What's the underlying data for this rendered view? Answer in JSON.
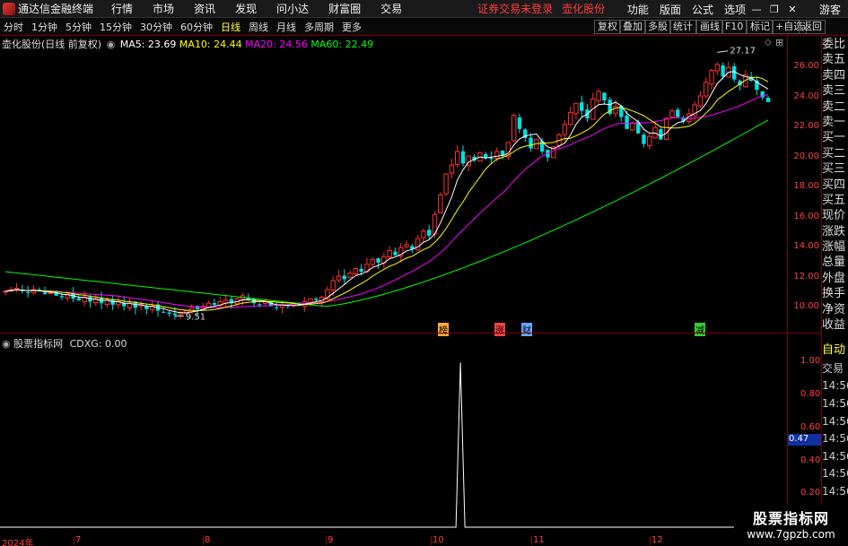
{
  "titlebar": {
    "app_name": "通达信金融终端",
    "menus": [
      "行情",
      "市场",
      "资讯",
      "发现",
      "问小达",
      "财富圈",
      "交易"
    ],
    "warning": "证券交易未登录",
    "stock_name": "壶化股份",
    "right_menus": [
      "功能",
      "版面",
      "公式",
      "选项"
    ],
    "guest": "游客"
  },
  "toolbar": {
    "periods": [
      "分时",
      "1分钟",
      "5分钟",
      "15分钟",
      "30分钟",
      "60分钟",
      "日线",
      "周线",
      "月线",
      "多周期",
      "更多"
    ],
    "active_period": "日线",
    "right_buttons": [
      "复权",
      "叠加",
      "多股",
      "统计",
      "画线",
      "F10",
      "标记",
      "+自选",
      "返回"
    ]
  },
  "main_legend": {
    "title": "壶化股份(日线 前复权)",
    "ma": [
      {
        "label": "MA5: 23.69",
        "color": "#ffffff"
      },
      {
        "label": "MA10: 24.44",
        "color": "#ffff00"
      },
      {
        "label": "MA20: 24.56",
        "color": "#ff00ff"
      },
      {
        "label": "MA60: 22.49",
        "color": "#00ff00"
      }
    ]
  },
  "price_axis": [
    "26.00",
    "24.00",
    "22.00",
    "20.00",
    "18.00",
    "16.00",
    "14.00",
    "12.00",
    "10.00"
  ],
  "annotations": {
    "high": "27.17",
    "low": "9.51"
  },
  "event_tags": [
    {
      "text": "榜",
      "color": "#ffaa33"
    },
    {
      "text": "涨",
      "color": "#ff4444"
    },
    {
      "text": "财",
      "color": "#66aaff"
    },
    {
      "text": "减",
      "color": "#33cc33"
    }
  ],
  "indicator": {
    "name": "股票指标网",
    "label": "CDXG: 0.00",
    "axis": [
      "1.00",
      "0.80",
      "0.60",
      "0.40",
      "0.20"
    ],
    "current": "0.47"
  },
  "sidepanel": {
    "items": [
      "委比",
      "卖五",
      "卖四",
      "卖三",
      "卖二",
      "卖一",
      "买一",
      "买二",
      "买三",
      "买四",
      "买五",
      "现价",
      "涨跌",
      "涨幅",
      "总量",
      "外盘",
      "换手",
      "净资",
      "收益"
    ],
    "lower": [
      "自动",
      "交易",
      "14:56",
      "14:56",
      "14:56",
      "14:56",
      "14:56",
      "14:56",
      "14:56",
      "14:56"
    ]
  },
  "x_axis": [
    "2024年",
    "7",
    "8",
    "9",
    "10",
    "11",
    "12"
  ],
  "watermark": {
    "title": "股票指标网",
    "url": "www.7gpzb.com"
  },
  "chart_data": {
    "type": "candlestick",
    "title": "壶化股份(日线 前复权)",
    "x": [
      "2024年",
      "7",
      "8",
      "9",
      "10",
      "11",
      "12"
    ],
    "ylim": [
      9.0,
      27.5
    ],
    "closes": [
      11.1,
      11.2,
      11.3,
      11.1,
      11.0,
      11.2,
      11.1,
      10.9,
      11.0,
      10.8,
      10.7,
      10.9,
      10.6,
      10.5,
      10.7,
      10.4,
      10.6,
      10.3,
      10.5,
      10.2,
      10.4,
      10.1,
      10.3,
      10.0,
      10.2,
      9.9,
      10.1,
      9.8,
      9.7,
      9.6,
      9.51,
      9.7,
      9.8,
      10.0,
      9.9,
      10.1,
      10.3,
      10.2,
      10.4,
      10.5,
      10.3,
      10.6,
      10.8,
      10.5,
      10.3,
      10.2,
      10.4,
      10.1,
      10.0,
      10.2,
      10.1,
      10.3,
      10.2,
      10.4,
      10.6,
      10.5,
      10.7,
      11.2,
      11.8,
      12.1,
      11.9,
      12.3,
      12.6,
      12.4,
      12.9,
      13.2,
      13.0,
      13.4,
      13.8,
      13.5,
      14.0,
      14.2,
      13.9,
      14.6,
      15.1,
      14.8,
      16.2,
      17.5,
      18.9,
      19.5,
      20.4,
      19.6,
      20.1,
      19.8,
      20.3,
      20.0,
      19.9,
      20.4,
      20.1,
      21.0,
      22.8,
      21.9,
      21.3,
      20.6,
      21.2,
      20.4,
      20.0,
      20.7,
      21.5,
      22.2,
      23.0,
      23.6,
      23.1,
      22.6,
      23.9,
      24.4,
      23.8,
      22.9,
      23.4,
      22.7,
      21.9,
      22.3,
      21.6,
      20.9,
      21.4,
      22.0,
      21.2,
      22.6,
      23.1,
      22.7,
      22.4,
      22.9,
      23.5,
      24.1,
      25.0,
      25.8,
      26.2,
      25.4,
      26.0,
      25.2,
      24.8,
      25.5,
      25.1,
      24.5,
      24.0,
      23.69
    ],
    "ma": [
      {
        "name": "MA5",
        "last": 23.69,
        "color": "#ffffff"
      },
      {
        "name": "MA10",
        "last": 24.44,
        "color": "#ffff00"
      },
      {
        "name": "MA20",
        "last": 24.56,
        "color": "#ff00ff"
      },
      {
        "name": "MA60",
        "last": 22.49,
        "color": "#00ff00"
      }
    ],
    "indicator": {
      "name": "CDXG",
      "ylim": [
        0,
        1.1
      ],
      "spike_index": 78,
      "spike_value": 1.0
    }
  }
}
